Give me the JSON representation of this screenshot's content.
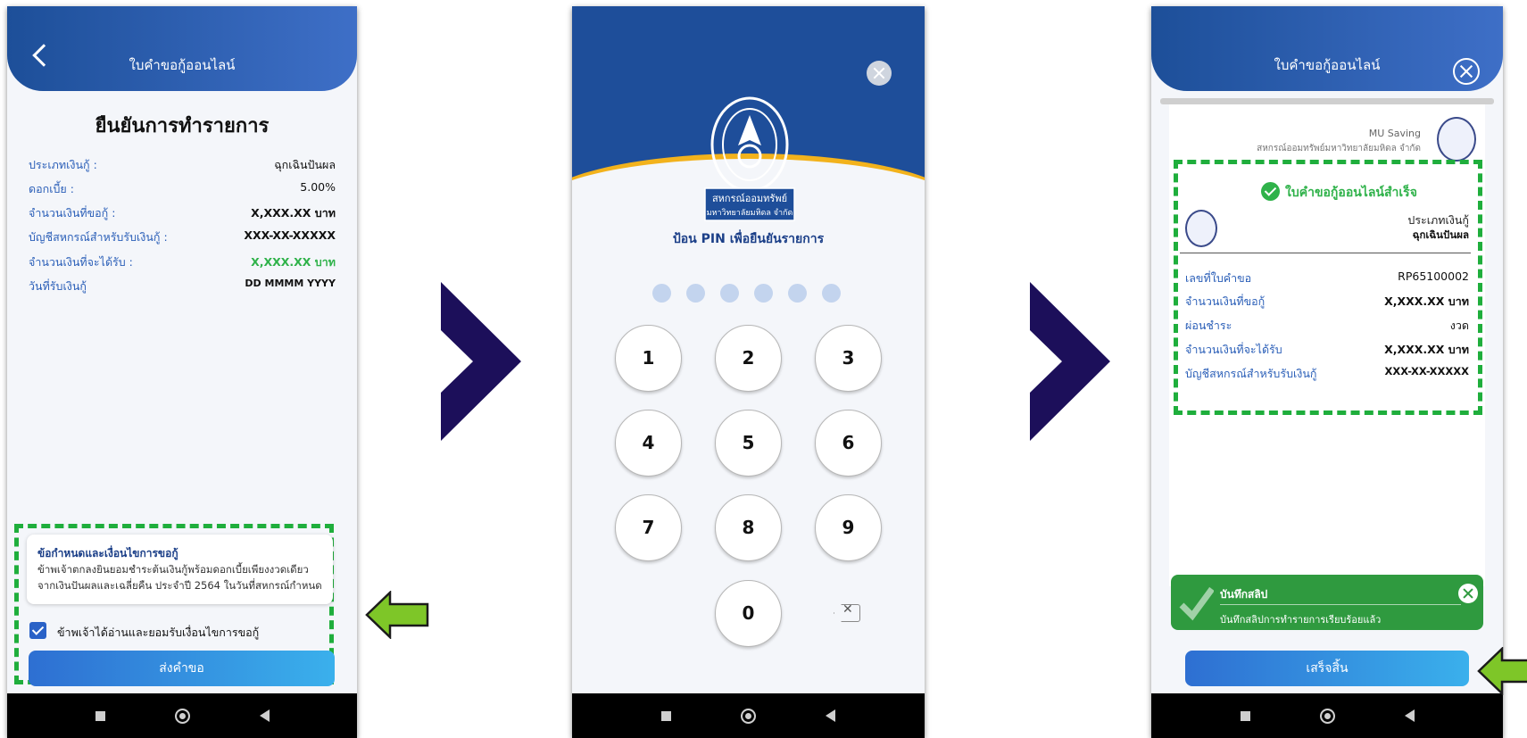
{
  "screen1": {
    "header_title": "ใบคำขอกู้ออนไลน์",
    "page_title": "ยืนยันการทำรายการ",
    "rows": [
      {
        "label": "ประเภทเงินกู้ :",
        "value": "ฉุกเฉินปันผล"
      },
      {
        "label": "ดอกเบี้ย :",
        "value": "5.00%"
      },
      {
        "label": "จำนวนเงินที่ขอกู้ :",
        "value": "X,XXX.XX บาท"
      },
      {
        "label": "บัญชีสหกรณ์สำหรับรับเงินกู้ :",
        "value": "XXX-XX-XXXXX"
      },
      {
        "label": "จำนวนเงินที่จะได้รับ :",
        "value": "X,XXX.XX บาท"
      },
      {
        "label": "วันที่รับเงินกู้",
        "value": "DD MMMM YYYY"
      }
    ],
    "terms_title": "ข้อกำหนดและเงื่อนไขการขอกู้",
    "terms_line1": "ข้าพเจ้าตกลงยินยอมชำระต้นเงินกู้พร้อมดอกเบี้ยเพียงงวดเดียว",
    "terms_line2": "จากเงินปันผลและเฉลี่ยคืน ประจำปี 2564 ในวันที่สหกรณ์กำหนด",
    "checkbox_label": "ข้าพเจ้าได้อ่านและยอมรับเงื่อนไขการขอกู้",
    "checkbox_checked": true,
    "submit_label": "ส่งคำขอ"
  },
  "screen2": {
    "logo_line1": "สหกรณ์ออมทรัพย์",
    "logo_line2": "มหาวิทยาลัยมหิดล จำกัด",
    "caption": "ป้อน PIN เพื่อยืนยันรายการ",
    "pin_length": 6,
    "keys": [
      "1",
      "2",
      "3",
      "4",
      "5",
      "6",
      "7",
      "8",
      "9",
      "0"
    ]
  },
  "screen3": {
    "header_title": "ใบคำขอกู้ออนไลน์",
    "corner_title": "MU Saving",
    "corner_sub": "สหกรณ์ออมทรัพย์มหาวิทยาลัยมหิดล จำกัด",
    "success_text": "ใบคำขอกู้ออนไลน์สำเร็จ",
    "type_label": "ประเภทเงินกู้",
    "type_value": "ฉุกเฉินปันผล",
    "rows": [
      {
        "label": "เลขที่ใบคำขอ",
        "value": "RP65100002"
      },
      {
        "label": "จำนวนเงินที่ขอกู้",
        "value": "X,XXX.XX บาท"
      },
      {
        "label": "ผ่อนชำระ",
        "value": "งวด"
      },
      {
        "label": "จำนวนเงินที่จะได้รับ",
        "value": "X,XXX.XX บาท"
      },
      {
        "label": "บัญชีสหกรณ์สำหรับรับเงินกู้",
        "value": "XXX-XX-XXXXX"
      }
    ],
    "toast_title": "บันทึกสลิป",
    "toast_msg": "บันทึกสลิปการทำรายการเรียบร้อยแล้ว",
    "finish_label": "เสร็จสิ้น"
  },
  "colors": {
    "header_blue": "#1d4f99",
    "highlight_green": "#1fae3c",
    "arrow_purple": "#1c0f5a",
    "arrow_green": "#7ec628"
  }
}
